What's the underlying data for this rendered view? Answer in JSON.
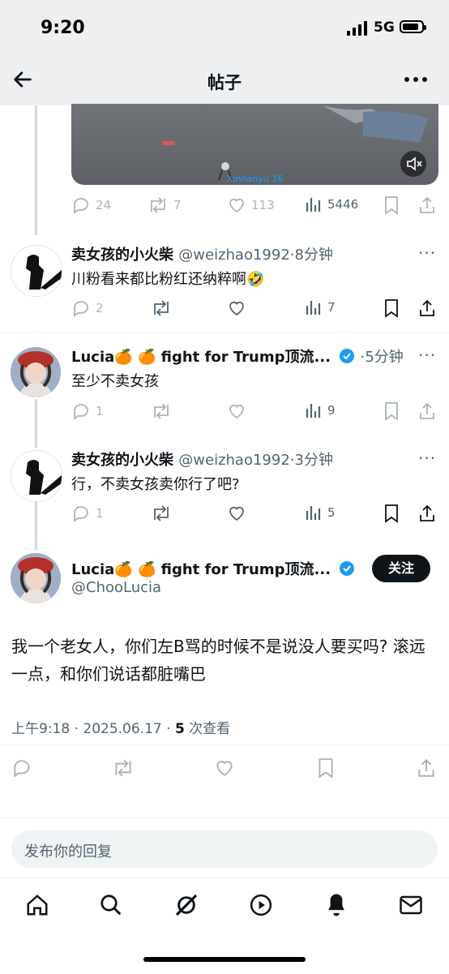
{
  "status_bar": {
    "time": "9:20",
    "network": "5G"
  },
  "nav": {
    "title": "帖子",
    "back_icon": "arrow-left-icon",
    "more_icon": "more-horizontal-icon"
  },
  "top_post": {
    "media_watermark": "Xinhanyu 16",
    "actions": {
      "replies": "24",
      "reposts": "7",
      "likes": "113",
      "views": "5446"
    }
  },
  "replies": [
    {
      "name": "卖女孩的小火柴",
      "handle": "@weizhao1992",
      "time": "·8分钟",
      "text": "川粉看来都比粉红还纳粹啊🤣",
      "replies": "2",
      "reposts": "",
      "likes": "",
      "views": "7"
    },
    {
      "name": "Lucia🍊 🍊 fight for Trump顶流...",
      "handle": "",
      "time": "·5分钟",
      "text": "至少不卖女孩",
      "replies": "1",
      "reposts": "",
      "likes": "",
      "views": "9"
    },
    {
      "name": "卖女孩的小火柴",
      "handle": "@weizhao1992",
      "time": "·3分钟",
      "text": "行，不卖女孩卖你行了吧?",
      "replies": "1",
      "reposts": "",
      "likes": "",
      "views": "5"
    }
  ],
  "main_post": {
    "name": "Lucia🍊 🍊 fight for Trump顶流...",
    "handle": "@ChooLucia",
    "follow_label": "关注",
    "text": "我一个老女人，你们左B骂的时候不是说没人要买吗? 滚远一点，和你们说话都脏嘴巴",
    "meta_prefix": "上午9:18 · 2025.06.17 · ",
    "views_count": "5",
    "views_label": " 次查看"
  },
  "reply_input": {
    "placeholder": "发布你的回复"
  },
  "tab_bar": [
    "home-icon",
    "search-icon",
    "grok-icon",
    "video-icon",
    "notifications-icon",
    "messages-icon"
  ],
  "colors": {
    "verified": "#1d9bf0",
    "text": "#0f1419",
    "muted": "#536471"
  }
}
